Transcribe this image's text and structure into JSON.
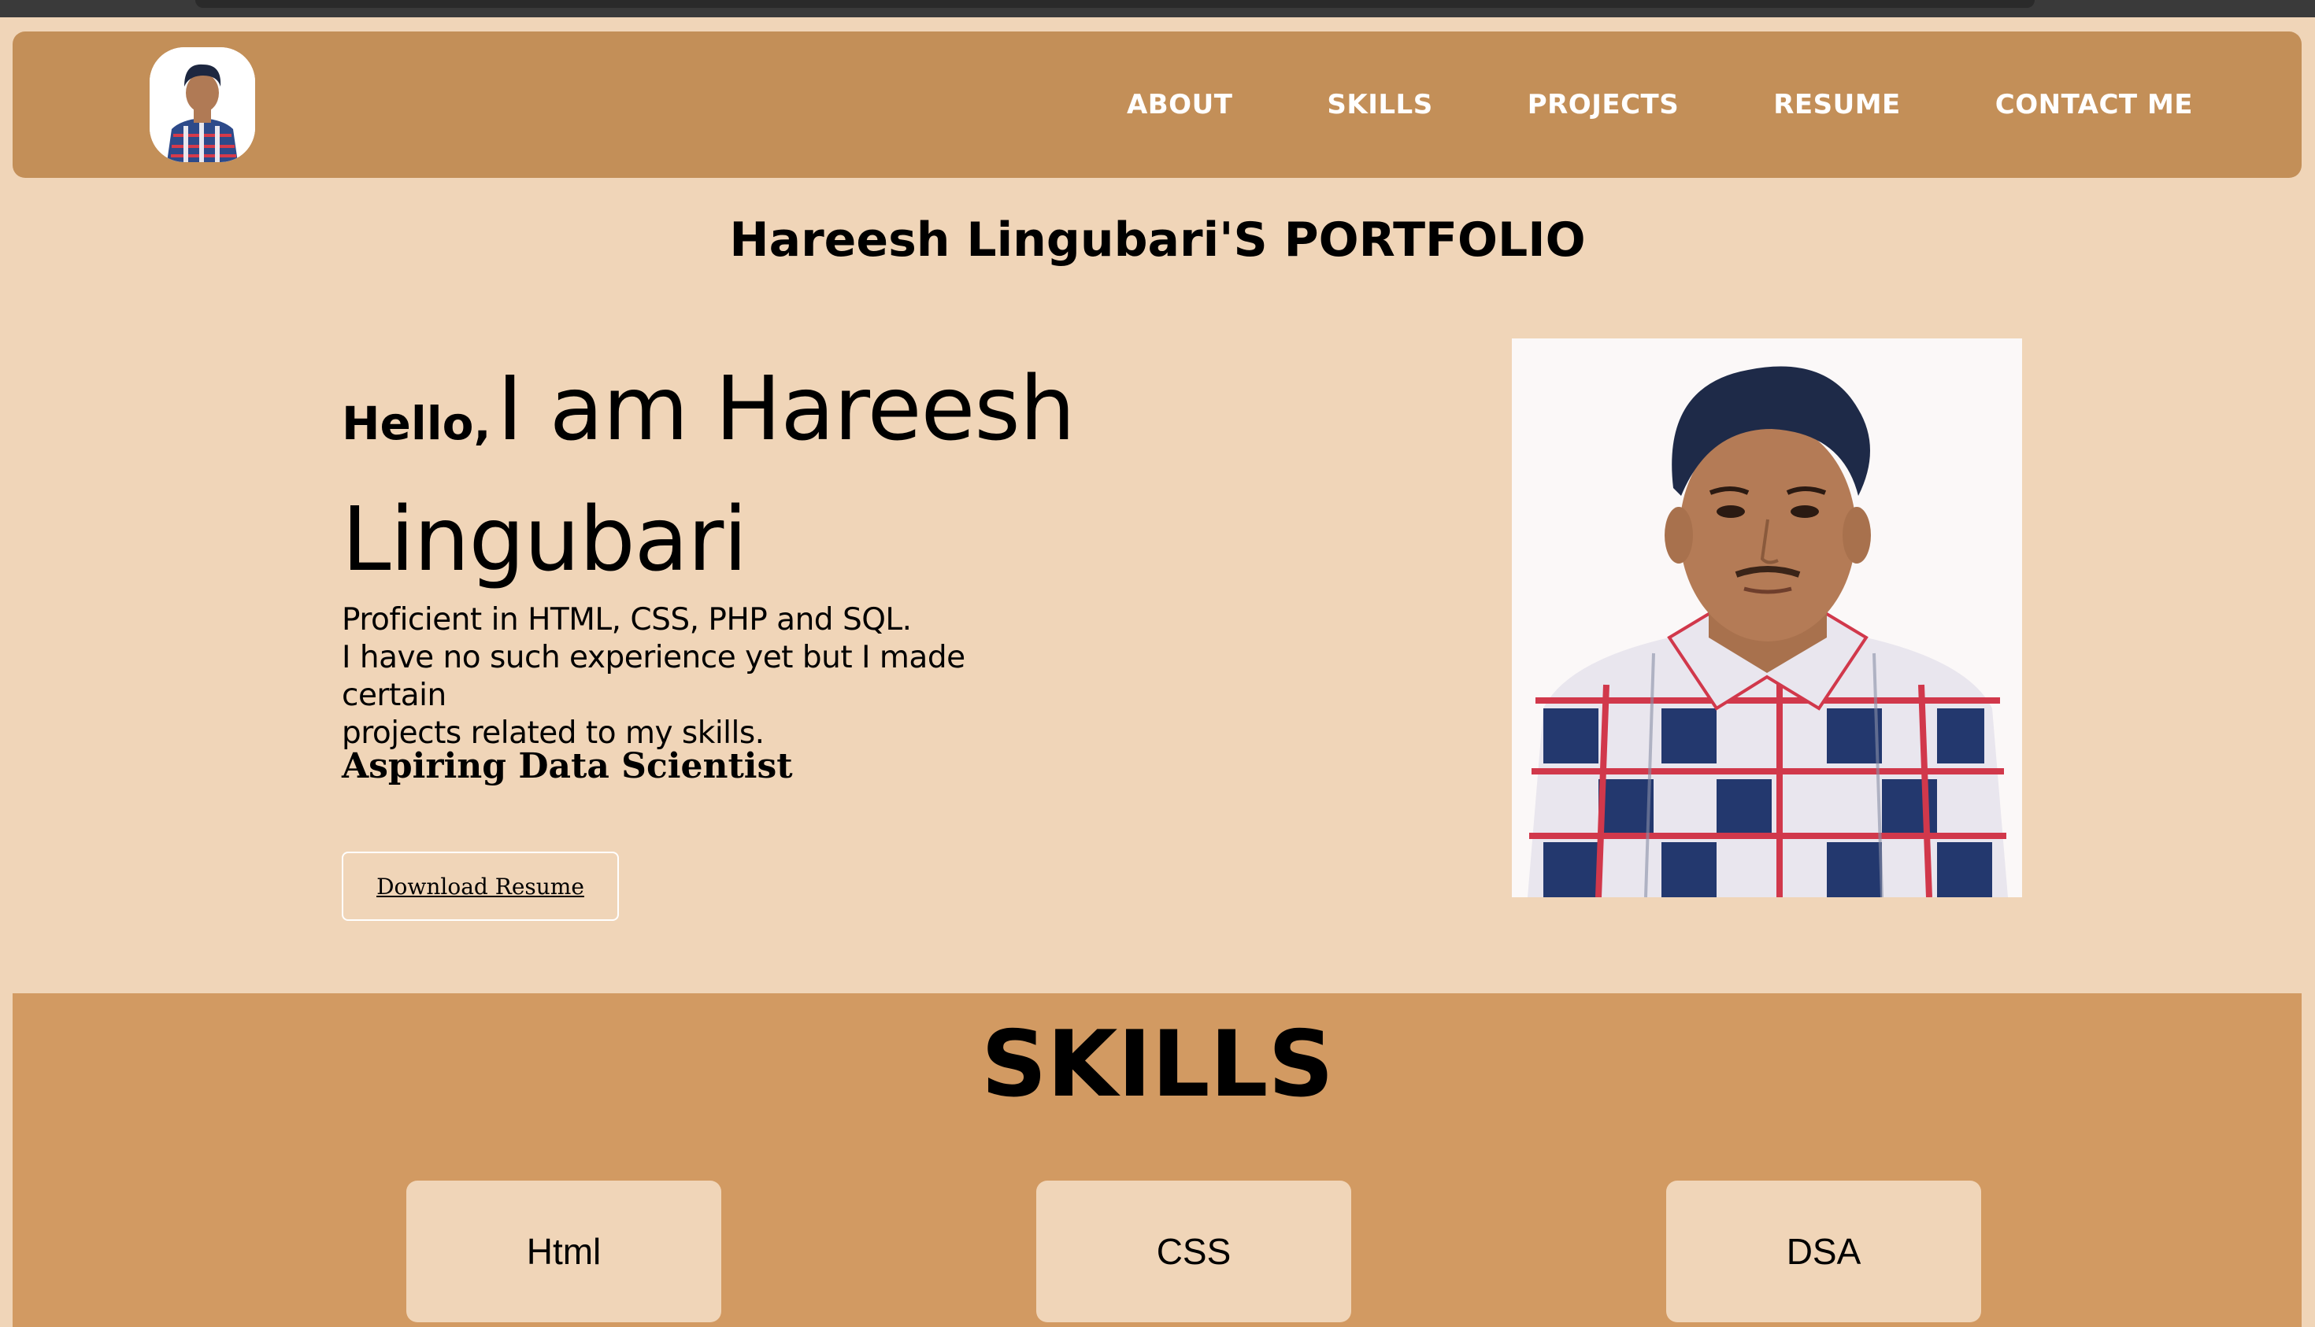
{
  "nav": {
    "links": [
      "ABOUT",
      "SKILLS",
      "PROJECTS",
      "RESUME",
      "CONTACT ME"
    ]
  },
  "page_title": "Hareesh Lingubari'S PORTFOLIO",
  "hero": {
    "hello": "Hello,",
    "name": "I am Hareesh Lingubari",
    "description": [
      "Proficient in HTML, CSS, PHP and SQL.",
      "I have no such experience yet but I made certain",
      "projects related to my skills."
    ],
    "role": "Aspiring Data Scientist",
    "download_label": "Download Resume"
  },
  "skills": {
    "title": "SKILLS",
    "items": [
      "Html",
      "CSS",
      "DSA"
    ]
  },
  "colors": {
    "page_bg": "#f0d5b8",
    "nav_bg": "#c38f58",
    "skills_bg": "#d29a62"
  }
}
